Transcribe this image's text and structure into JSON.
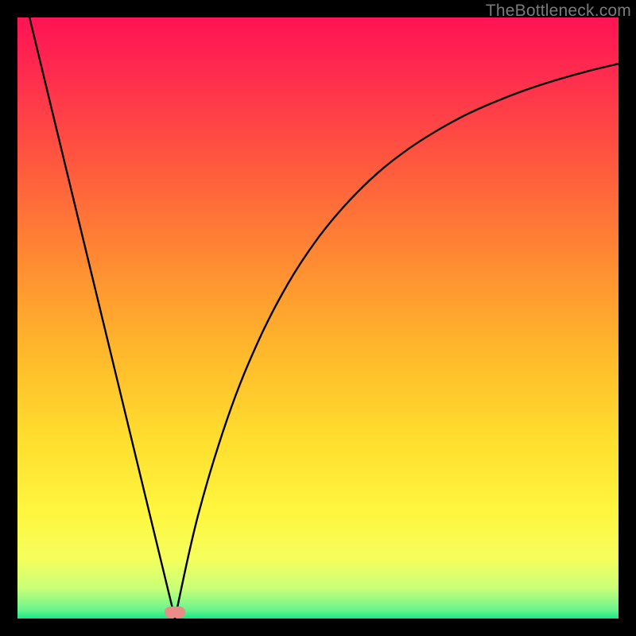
{
  "watermark": "TheBottleneck.com",
  "marker": {
    "x_frac": 0.262,
    "y_frac": 0.989,
    "color": "#e98b86"
  },
  "gradient_stops": [
    {
      "pos": 0.0,
      "color": "#ff1454"
    },
    {
      "pos": 0.1,
      "color": "#ff2e4e"
    },
    {
      "pos": 0.25,
      "color": "#ff5b3e"
    },
    {
      "pos": 0.4,
      "color": "#ff8a33"
    },
    {
      "pos": 0.55,
      "color": "#ffb72c"
    },
    {
      "pos": 0.7,
      "color": "#ffde2e"
    },
    {
      "pos": 0.82,
      "color": "#fff63f"
    },
    {
      "pos": 0.9,
      "color": "#f6ff5c"
    },
    {
      "pos": 0.95,
      "color": "#c8ff78"
    },
    {
      "pos": 0.985,
      "color": "#6cf58e"
    },
    {
      "pos": 1.0,
      "color": "#17e885"
    }
  ],
  "chart_data": {
    "type": "line",
    "title": "",
    "xlabel": "",
    "ylabel": "",
    "xlim": [
      0,
      1
    ],
    "ylim": [
      0,
      1
    ],
    "series": [
      {
        "name": "left-branch",
        "x": [
          0.02,
          0.262
        ],
        "y": [
          1.0,
          0.0
        ],
        "note": "straight line from top-left to valley"
      },
      {
        "name": "right-branch",
        "x": [
          0.262,
          0.3,
          0.35,
          0.4,
          0.45,
          0.5,
          0.55,
          0.6,
          0.65,
          0.7,
          0.75,
          0.8,
          0.85,
          0.9,
          0.95,
          1.0
        ],
        "y": [
          0.0,
          0.17,
          0.335,
          0.46,
          0.557,
          0.633,
          0.693,
          0.742,
          0.781,
          0.813,
          0.84,
          0.862,
          0.881,
          0.897,
          0.911,
          0.923
        ],
        "note": "monotone concave curve rising to the right"
      }
    ],
    "valley_x": 0.262
  }
}
